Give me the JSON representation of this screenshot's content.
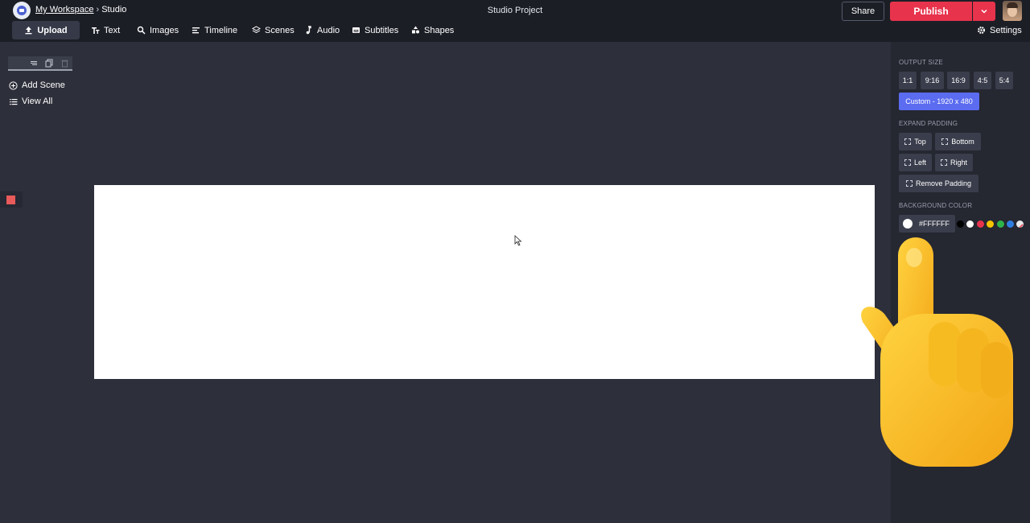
{
  "header": {
    "breadcrumb_workspace": "My Workspace",
    "breadcrumb_separator": "›",
    "breadcrumb_current": "Studio",
    "project_title": "Studio Project",
    "share_label": "Share",
    "publish_label": "Publish"
  },
  "toolbar": {
    "upload": "Upload",
    "text": "Text",
    "images": "Images",
    "timeline": "Timeline",
    "scenes": "Scenes",
    "audio": "Audio",
    "subtitles": "Subtitles",
    "shapes": "Shapes",
    "settings": "Settings"
  },
  "sidebar": {
    "add_scene": "Add Scene",
    "view_all": "View All"
  },
  "panel": {
    "output_size_title": "OUTPUT SIZE",
    "sizes": [
      "1:1",
      "9:16",
      "16:9",
      "4:5",
      "5:4"
    ],
    "custom_size": "Custom - 1920 x 480",
    "expand_padding_title": "EXPAND PADDING",
    "pad_top": "Top",
    "pad_bottom": "Bottom",
    "pad_left": "Left",
    "pad_right": "Right",
    "remove_padding": "Remove Padding",
    "background_color_title": "BACKGROUND COLOR",
    "background_hex": "#FFFFFF",
    "swatches": [
      "#000000",
      "#ffffff",
      "#e8334c",
      "#f5c400",
      "#2fb34a",
      "#2f7de1"
    ]
  },
  "colors": {
    "accent": "#5b6cf0",
    "publish": "#e8334c",
    "canvas": "#ffffff"
  }
}
